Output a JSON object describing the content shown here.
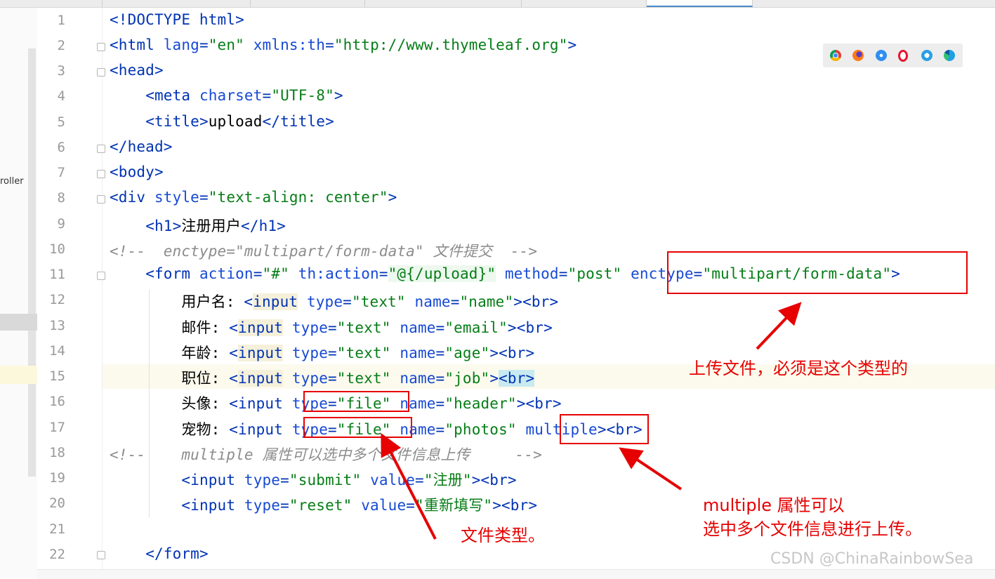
{
  "editor": {
    "left_panel_label": "roller",
    "line_numbers": [
      "1",
      "2",
      "3",
      "4",
      "5",
      "6",
      "7",
      "8",
      "9",
      "10",
      "11",
      "12",
      "13",
      "14",
      "15",
      "16",
      "17",
      "18",
      "19",
      "20",
      "21",
      "22"
    ],
    "lines": {
      "l1": "<!DOCTYPE html>",
      "l2_tag": "<html",
      "l2_attr1": "lang",
      "l2_val1": "\"en\"",
      "l2_attr2": "xmlns:th",
      "l2_val2": "\"http://www.thymeleaf.org\"",
      "l2_end": ">",
      "l3": "<head>",
      "l4_tag": "<meta",
      "l4_attr": "charset",
      "l4_val": "\"UTF-8\"",
      "l4_end": ">",
      "l5_open": "<title>",
      "l5_text": "upload",
      "l5_close": "</title>",
      "l6": "</head>",
      "l7": "<body>",
      "l8_tag": "<div",
      "l8_attr": "style",
      "l8_val1": "\"text-align: ",
      "l8_val2": "center",
      "l8_val3": "\"",
      "l8_end": ">",
      "l9_open": "<h1>",
      "l9_text": "注册用户",
      "l9_close": "</h1>",
      "l10": "<!--  enctype=\"multipart/form-data\" 文件提交  -->",
      "l11_tag": "<form",
      "l11_attr1": "action",
      "l11_val1": "\"#\"",
      "l11_attr2": "th:action",
      "l11_val2": "\"@{/upload}\"",
      "l11_attr3": "method",
      "l11_val3": "\"post\"",
      "l11_attr4": "enctype",
      "l11_val4": "\"multipart/form-data\"",
      "l11_end": ">",
      "l12_label": "用户名: ",
      "l12_name": "\"name\"",
      "l13_label": "邮件: ",
      "l13_name": "\"email\"",
      "l14_label": "年龄: ",
      "l14_name": "\"age\"",
      "l15_label": "职位: ",
      "l15_name": "\"job\"",
      "l16_label": "头像: ",
      "l16_name": "\"header\"",
      "l17_label": "宠物: ",
      "l17_name": "\"photos\"",
      "l17_multiple": "multiple",
      "l18": "<!--    multiple 属性可以选中多个文件信息上传     -->",
      "l19_tag": "<input",
      "l19_attr1": "type",
      "l19_val1": "\"submit\"",
      "l19_attr2": "value",
      "l19_val2": "\"注册\"",
      "l20_tag": "<input",
      "l20_attr1": "type",
      "l20_val1": "\"reset\"",
      "l20_attr2": "value",
      "l20_val2": "\"重新填写\"",
      "l22": "</form>",
      "input_tag_open": "<",
      "input_word": "input",
      "type_attr": "type",
      "text_val": "\"text\"",
      "file_val": "\"file\"",
      "name_attr": "name",
      "br_tag": "<br>",
      "close_angle": ">",
      "eq": "="
    }
  },
  "annotations": {
    "enctype_note": "上传文件，必须是这个类型的",
    "file_type_note": "文件类型。",
    "multiple_note": "multiple 属性可以\n选中多个文件信息进行上传。"
  },
  "browser_icons": [
    "chrome-icon",
    "firefox-icon",
    "safari-icon",
    "opera-icon",
    "ie-icon",
    "edge-icon"
  ],
  "colors": {
    "tag": "#0033b3",
    "string": "#067d17",
    "comment": "#8c8c8c",
    "annotation": "#e60000"
  },
  "watermark": "CSDN @ChinaRainbowSea"
}
